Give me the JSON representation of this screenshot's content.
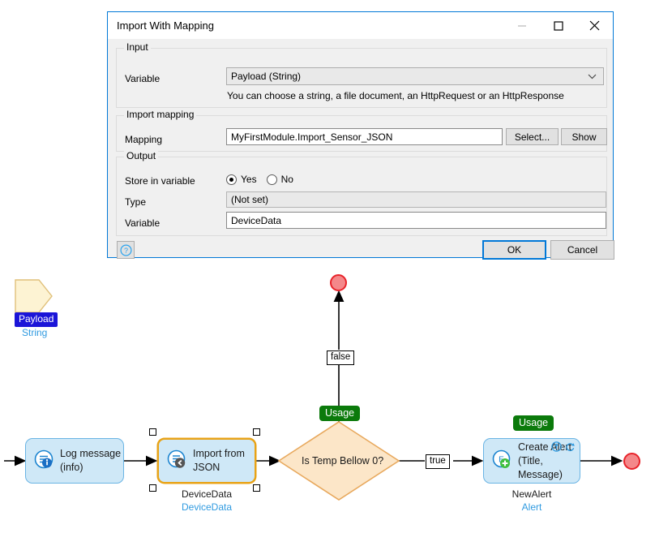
{
  "dialog": {
    "title": "Import With Mapping",
    "window_controls": [
      {
        "name": "minimize",
        "glyph": "minimize-icon",
        "enabled": false
      },
      {
        "name": "maximize",
        "glyph": "maximize-icon",
        "enabled": true
      },
      {
        "name": "close",
        "glyph": "close-icon",
        "enabled": true
      }
    ],
    "groups": {
      "input": {
        "legend": "Input",
        "variable_label": "Variable",
        "variable_value": "Payload (String)",
        "hint": "You can choose a string, a file document, an HttpRequest or an HttpResponse"
      },
      "import_mapping": {
        "legend": "Import mapping",
        "mapping_label": "Mapping",
        "mapping_value": "MyFirstModule.Import_Sensor_JSON",
        "select_button": "Select...",
        "show_button": "Show"
      },
      "output": {
        "legend": "Output",
        "store_label": "Store in variable",
        "radio_yes": "Yes",
        "radio_no": "No",
        "radio_selected": "Yes",
        "type_label": "Type",
        "type_value": "(Not set)",
        "variable_label": "Variable",
        "variable_value": "DeviceData"
      }
    },
    "footer": {
      "help_icon": "help-icon",
      "ok_button": "OK",
      "cancel_button": "Cancel"
    },
    "accent_color": "#0078d7"
  },
  "flow": {
    "payload": {
      "name": "Payload",
      "type": "String",
      "label_color": "#1b15d8",
      "type_color": "#2f9ae0",
      "shape_fill": "#fdf3d3",
      "shape_stroke": "#e0c07a"
    },
    "nodes": [
      {
        "id": "log-message",
        "icon": "log-message-icon",
        "line1": "Log message",
        "line2": "(info)",
        "selected": false,
        "caption": "",
        "caption_type": ""
      },
      {
        "id": "import-from-json",
        "icon": "import-from-json-icon",
        "line1": "Import from",
        "line2": "JSON",
        "selected": true,
        "caption": "DeviceData",
        "caption_type": "DeviceData"
      },
      {
        "id": "create-alert",
        "icon": "create-alert-icon",
        "line1": "Create Alert",
        "line2": "(Title, Message)",
        "selected": false,
        "caption": "NewAlert",
        "caption_type": "Alert",
        "badges": [
          "commit-icon",
          "refresh-icon"
        ]
      }
    ],
    "decision": {
      "id": "is-temp-below-zero",
      "text": "Is Temp Bellow 0?",
      "fill": "#fce6c8",
      "stroke": "#e8a95e"
    },
    "usage_badges": [
      {
        "id": "usage-decision",
        "label": "Usage"
      },
      {
        "id": "usage-create-alert",
        "label": "Usage"
      }
    ],
    "edge_labels": [
      {
        "id": "edge-false",
        "label": "false"
      },
      {
        "id": "edge-true",
        "label": "true"
      }
    ],
    "endpoints": [
      {
        "id": "end-false",
        "color": "#f4888a"
      },
      {
        "id": "end-true",
        "color": "#f4888a"
      }
    ],
    "usage_badge_color": "#0b7a0b",
    "node_fill": "#cfe8f7",
    "node_stroke": "#6ab4e4",
    "selected_stroke": "#e8a317"
  }
}
